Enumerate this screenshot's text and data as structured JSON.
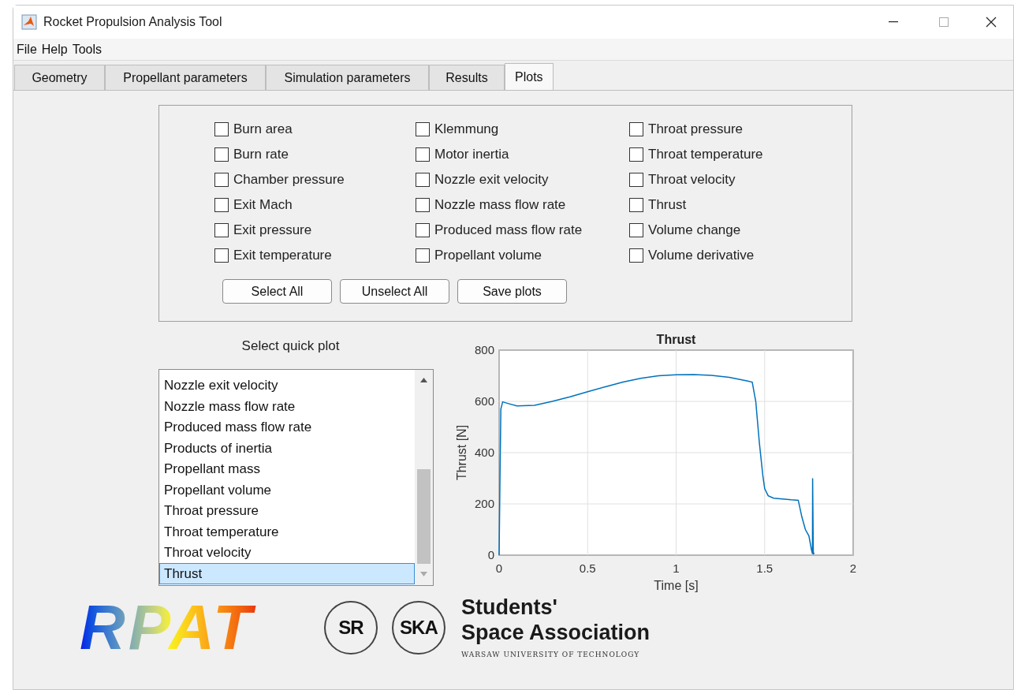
{
  "window": {
    "title": "Rocket Propulsion Analysis Tool"
  },
  "menu": [
    "File",
    "Help",
    "Tools"
  ],
  "tabs": [
    {
      "label": "Geometry",
      "selected": false
    },
    {
      "label": "Propellant parameters",
      "selected": false
    },
    {
      "label": "Simulation parameters",
      "selected": false
    },
    {
      "label": "Results",
      "selected": false
    },
    {
      "label": "Plots",
      "selected": true
    }
  ],
  "checkbox_columns": [
    [
      {
        "label": "Burn area",
        "checked": false
      },
      {
        "label": "Burn rate",
        "checked": false
      },
      {
        "label": "Chamber pressure",
        "checked": false
      },
      {
        "label": "Exit Mach",
        "checked": false
      },
      {
        "label": "Exit pressure",
        "checked": false
      },
      {
        "label": "Exit temperature",
        "checked": false
      }
    ],
    [
      {
        "label": "Klemmung",
        "checked": false
      },
      {
        "label": "Motor inertia",
        "checked": false
      },
      {
        "label": "Nozzle exit velocity",
        "checked": false
      },
      {
        "label": "Nozzle mass flow rate",
        "checked": false
      },
      {
        "label": "Produced mass flow rate",
        "checked": false
      },
      {
        "label": "Propellant volume",
        "checked": false
      }
    ],
    [
      {
        "label": "Throat pressure",
        "checked": false
      },
      {
        "label": "Throat temperature",
        "checked": false
      },
      {
        "label": "Throat velocity",
        "checked": false
      },
      {
        "label": "Thrust",
        "checked": false
      },
      {
        "label": "Volume change",
        "checked": false
      },
      {
        "label": "Volume derivative",
        "checked": false
      }
    ]
  ],
  "buttons": [
    "Select All",
    "Unselect All",
    "Save plots"
  ],
  "quick_plot": {
    "label": "Select quick plot",
    "items": [
      {
        "label": "Nozzle exit velocity",
        "selected": false
      },
      {
        "label": "Nozzle mass flow rate",
        "selected": false
      },
      {
        "label": "Produced mass flow rate",
        "selected": false
      },
      {
        "label": "Products of inertia",
        "selected": false
      },
      {
        "label": "Propellant mass",
        "selected": false
      },
      {
        "label": "Propellant volume",
        "selected": false
      },
      {
        "label": "Throat pressure",
        "selected": false
      },
      {
        "label": "Throat temperature",
        "selected": false
      },
      {
        "label": "Throat velocity",
        "selected": false
      },
      {
        "label": "Thrust",
        "selected": true
      }
    ]
  },
  "chart_data": {
    "type": "line",
    "title": "Thrust",
    "xlabel": "Time [s]",
    "ylabel": "Thrust [N]",
    "x": [
      0,
      0.005,
      0.01,
      0.02,
      0.05,
      0.1,
      0.2,
      0.3,
      0.4,
      0.5,
      0.6,
      0.7,
      0.8,
      0.9,
      1.0,
      1.1,
      1.2,
      1.3,
      1.4,
      1.43,
      1.45,
      1.47,
      1.49,
      1.5,
      1.52,
      1.55,
      1.6,
      1.65,
      1.69,
      1.71,
      1.73,
      1.75,
      1.765,
      1.77,
      1.771,
      1.775,
      1.78
    ],
    "grid": true,
    "series": [
      {
        "color": "#0072bd",
        "values": [
          0,
          300,
          570,
          598,
          592,
          582,
          585,
          600,
          618,
          638,
          657,
          675,
          690,
          700,
          704,
          705,
          702,
          694,
          680,
          675,
          600,
          440,
          310,
          260,
          232,
          222,
          219,
          216,
          214,
          150,
          100,
          75,
          20,
          5,
          300,
          3,
          10
        ]
      }
    ],
    "xlim": [
      0,
      2
    ],
    "ylim": [
      0,
      800
    ],
    "xticks": [
      0,
      0.5,
      1,
      1.5,
      2
    ],
    "yticks": [
      0,
      200,
      400,
      600,
      800
    ]
  },
  "logos": {
    "rpat": "RPAT",
    "badges": [
      "SR",
      "SKA"
    ],
    "association": [
      "Students'",
      "Space Association"
    ],
    "university": "WARSAW UNIVERSITY OF TECHNOLOGY"
  }
}
